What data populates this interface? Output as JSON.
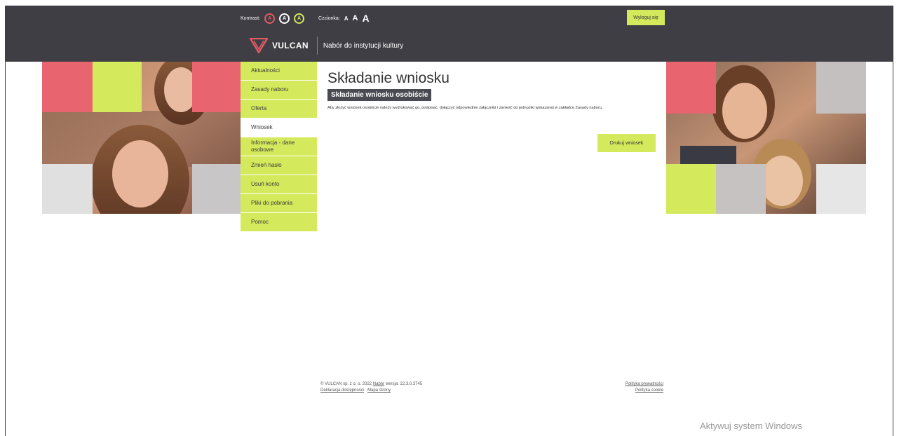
{
  "header": {
    "contrast_label": "Kontrast:",
    "contrast_buttons": [
      "A",
      "A",
      "A"
    ],
    "font_label": "Czcionka:",
    "font_sizes": [
      "A",
      "A",
      "A"
    ],
    "logout_label": "Wyloguj się",
    "logo_text": "VULCAN",
    "app_name": "Nabór do instytucji kultury"
  },
  "colors": {
    "accent": "#d4ea5c",
    "header_bg": "#3e3e44",
    "brand_red": "#e05a64"
  },
  "sidebar": {
    "items": [
      {
        "label": "Aktualności"
      },
      {
        "label": "Zasady naboru"
      },
      {
        "label": "Oferta"
      },
      {
        "label": "Wniosek",
        "active": true
      },
      {
        "label": "Informacja - dane osobowe"
      },
      {
        "label": "Zmień hasło"
      },
      {
        "label": "Usuń konto"
      },
      {
        "label": "Pliki do pobrania"
      },
      {
        "label": "Pomoc"
      }
    ]
  },
  "main": {
    "title": "Składanie wniosku",
    "subtitle": "Składanie wniosku osobiście",
    "body": "Aby złożyć wniosek osobiście należy wydrukować go, podpisać, dołączyć odpowiednie załączniki i zanieść do jednostki wskazanej w zakładce Zasady naboru.",
    "print_button": "Drukuj wniosek"
  },
  "footer": {
    "copyright_prefix": "© VULCAN sp. z o. o. 2022",
    "nabor_link": "Nabór",
    "version": "wersja: 22.3.0.3745",
    "accessibility_link": "Deklaracja dostępności",
    "sitemap_link": "Mapa strony",
    "privacy_link": "Polityka prywatności",
    "cookie_link": "Polityka cookie"
  },
  "os_watermark": {
    "title": "Aktywuj system Windows"
  }
}
